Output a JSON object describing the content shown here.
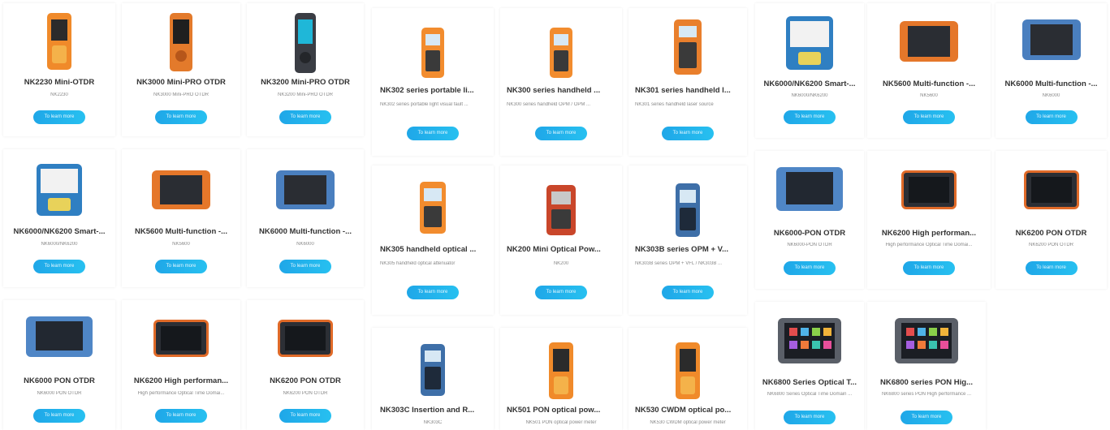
{
  "button_label": "To learn more",
  "cards": [
    {
      "title": "NK2230 Mini-OTDR",
      "desc": "NK2230",
      "device": "handheld-orange"
    },
    {
      "title": "NK3000 Mini-PRO OTDR",
      "desc": "NK3000 Mini-PRO OTDR",
      "device": "handheld-orange-tall"
    },
    {
      "title": "NK3200 Mini-PRO OTDR",
      "desc": "NK3200 Mini-PRO OTDR",
      "device": "handheld-dark"
    },
    {
      "title": "NK6000/NK6200 Smart-...",
      "desc": "NK6000/NK6200",
      "device": "tablet-blue"
    },
    {
      "title": "NK5600 Multi-function -...",
      "desc": "NK5600",
      "device": "tablet-orange"
    },
    {
      "title": "NK6000 Multi-function -...",
      "desc": "NK6000",
      "device": "tablet-blue"
    },
    {
      "title": "NK6000 PON OTDR",
      "desc": "NK6000 PON OTDR",
      "device": "tablet-blue-wide"
    },
    {
      "title": "NK6200 High performan...",
      "desc": "High performance Optical Time Domai...",
      "device": "tablet-dark-orange"
    },
    {
      "title": "NK6200 PON OTDR",
      "desc": "NK6200 PON OTDR",
      "device": "tablet-dark-orange"
    },
    {
      "title": "NK302 series portable li...",
      "desc": "NK302 series portable light visual fault ...",
      "device": "meter-orange"
    },
    {
      "title": "NK300 series handheld ...",
      "desc": "NK300 series handheld OPM / OPM ...",
      "device": "meter-orange"
    },
    {
      "title": "NK301 series handheld l...",
      "desc": "NK301 series handheld laser source",
      "device": "meter-orange"
    },
    {
      "title": "NK305 handheld optical ...",
      "desc": "NK305 handheld optical attenuator",
      "device": "meter-orange"
    },
    {
      "title": "NK200 Mini Optical Pow...",
      "desc": "NK200",
      "device": "meter-red"
    },
    {
      "title": "NK303B series OPM + V...",
      "desc": "NK303B series OPM + VFL / NK303B ...",
      "device": "meter-blue"
    },
    {
      "title": "NK303C Insertion and R...",
      "desc": "NK303C",
      "device": "meter-blue"
    },
    {
      "title": "NK501 PON optical pow...",
      "desc": "NK501 PON optical power meter",
      "device": "handheld-orange"
    },
    {
      "title": "NK530 CWDM optical po...",
      "desc": "NK530 CWDM optical power meter",
      "device": "handheld-orange"
    },
    {
      "title": "NK6000/NK6200 Smart-...",
      "desc": "NK6000/NK6200",
      "device": "tablet-blue"
    },
    {
      "title": "NK5600 Multi-function -...",
      "desc": "NK5600",
      "device": "tablet-orange"
    },
    {
      "title": "NK6000 Multi-function -...",
      "desc": "NK6000",
      "device": "tablet-blue"
    },
    {
      "title": "NK6000-PON OTDR",
      "desc": "NK6000-PON OTDR",
      "device": "tablet-blue-wide"
    },
    {
      "title": "NK6200 High performan...",
      "desc": "High performance Optical Time Domai...",
      "device": "tablet-dark-orange"
    },
    {
      "title": "NK6200 PON OTDR",
      "desc": "NK6200 PON OTDR",
      "device": "tablet-dark-orange"
    },
    {
      "title": "NK6800 Series Optical T...",
      "desc": "NK6800 Series Optical Time Domain ...",
      "device": "tablet-colorful"
    },
    {
      "title": "NK6800 series PON Hig...",
      "desc": "NK6800 series PON High performance ...",
      "device": "tablet-colorful"
    }
  ]
}
